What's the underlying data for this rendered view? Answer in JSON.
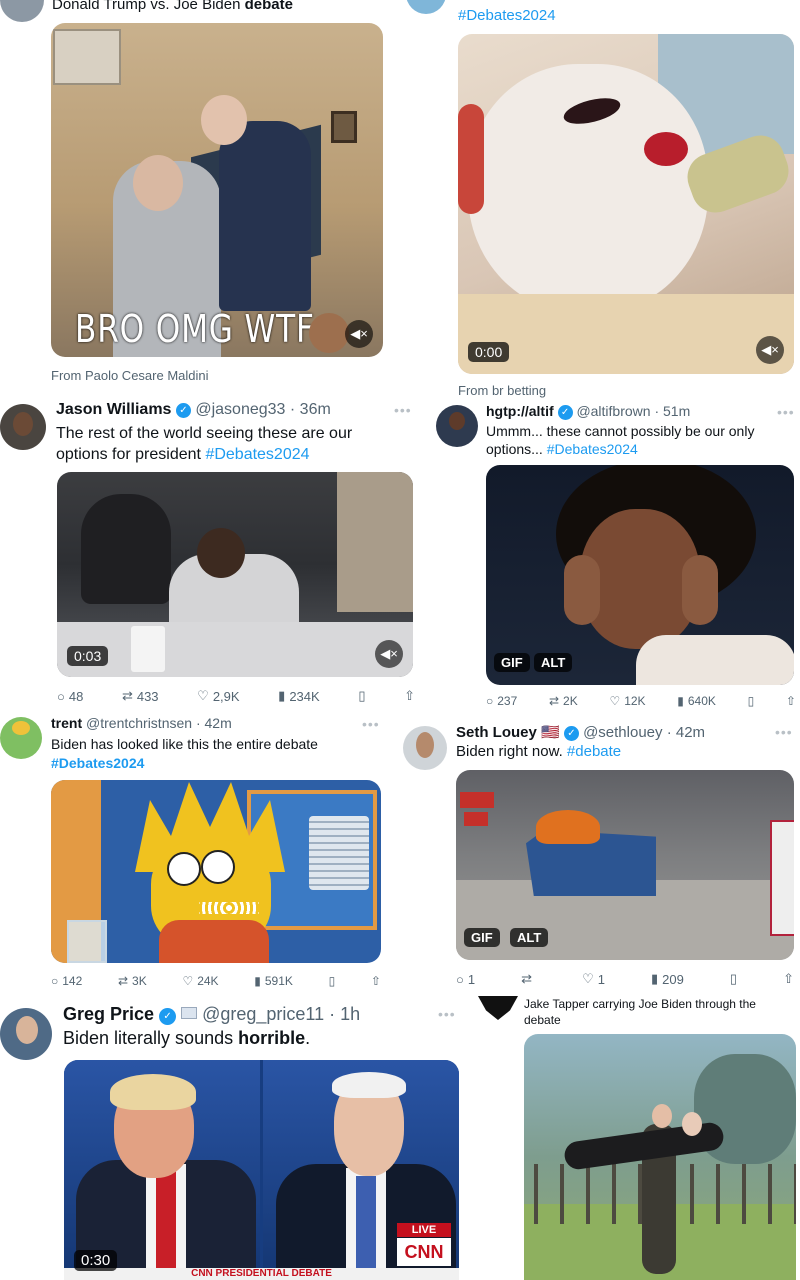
{
  "top_left": {
    "title_prefix": "Donald Trump vs. Joe Biden ",
    "title_bold": "debate",
    "overlay_text": "BRO OMG WTF",
    "source": "From Paolo Cesare Maldini"
  },
  "top_right": {
    "hashtag": "#Debates2024",
    "duration": "0:00",
    "source": "From br betting"
  },
  "tweet_jason": {
    "name": "Jason Williams",
    "handle": "@jasoneg33",
    "time": "· 36m",
    "text": "The rest of the world seeing these are our options for president",
    "hashtag": "#Debates2024",
    "duration": "0:03",
    "replies": "48",
    "retweets": "433",
    "likes": "2,9K",
    "views": "234K"
  },
  "tweet_hgtp": {
    "name": "hgtp://altif",
    "handle": "@altifbrown",
    "time": "· 51m",
    "text": "Ummm... these cannot possibly be our only options...",
    "hashtag": "#Debates2024",
    "gif": "GIF",
    "alt": "ALT",
    "replies": "237",
    "retweets": "2K",
    "likes": "12K",
    "views": "640K"
  },
  "tweet_trent": {
    "name": "trent",
    "handle": "@trentchristnsen",
    "time": "· 42m",
    "text": "Biden has looked like this the entire debate",
    "hashtag": "#Debates2024",
    "replies": "142",
    "retweets": "3K",
    "likes": "24K",
    "views": "591K"
  },
  "tweet_seth": {
    "name": "Seth Louey",
    "flag": "🇺🇸",
    "handle": "@sethlouey",
    "time": "· 42m",
    "text": "Biden right now.",
    "hashtag": "#debate",
    "gif": "GIF",
    "alt": "ALT",
    "replies": "1",
    "retweets": "",
    "likes": "1",
    "views": "209"
  },
  "tweet_greg": {
    "name": "Greg Price",
    "handle": "@greg_price11",
    "time": "· 1h",
    "text": "Biden literally sounds ",
    "text_bold": "horrible",
    "text_end": ".",
    "duration": "0:30",
    "live": "LIVE",
    "cnn": "CNN",
    "banner": "CNN PRESIDENTIAL DEBATE"
  },
  "bottom_right": {
    "caption": "Jake Tapper carrying Joe Biden through the debate"
  },
  "icons": {
    "reply": "reply-icon",
    "retweet": "retweet-icon",
    "like": "heart-icon",
    "views": "views-icon",
    "bookmark": "bookmark-icon",
    "share": "share-icon"
  },
  "colors": {
    "link": "#1d9bf0",
    "muted": "#536471",
    "verified": "#1d9bf0"
  }
}
